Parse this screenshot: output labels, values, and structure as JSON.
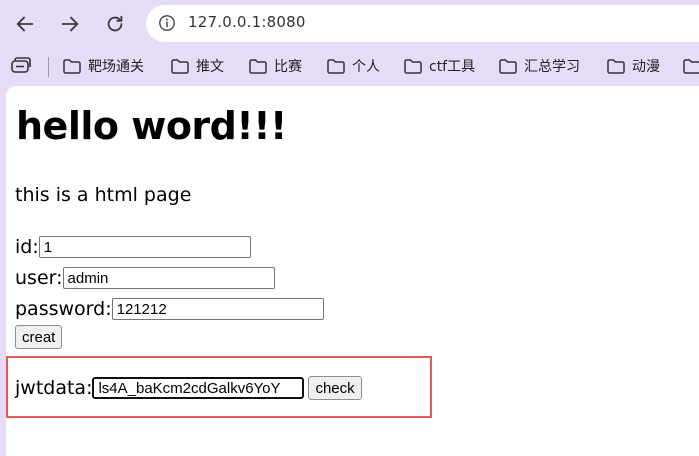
{
  "browser": {
    "url": "127.0.0.1:8080",
    "bookmarks": [
      {
        "label": "靶场通关"
      },
      {
        "label": "推文"
      },
      {
        "label": "比赛"
      },
      {
        "label": "个人"
      },
      {
        "label": "ctf工具"
      },
      {
        "label": "汇总学习"
      },
      {
        "label": "动漫"
      }
    ]
  },
  "page": {
    "heading": "hello word!!!",
    "description": "this is a html page",
    "form": {
      "id_label": "id:",
      "id_value": "1",
      "user_label": "user:",
      "user_value": "admin",
      "password_label": "password:",
      "password_value": "121212",
      "create_button": "creat"
    },
    "jwt": {
      "label": "jwtdata:",
      "value": "ls4A_baKcm2cdGalkv6YoY",
      "check_button": "check"
    }
  },
  "colors": {
    "chrome_bg": "#e6dcf8",
    "highlight_border": "#e05a5a"
  }
}
